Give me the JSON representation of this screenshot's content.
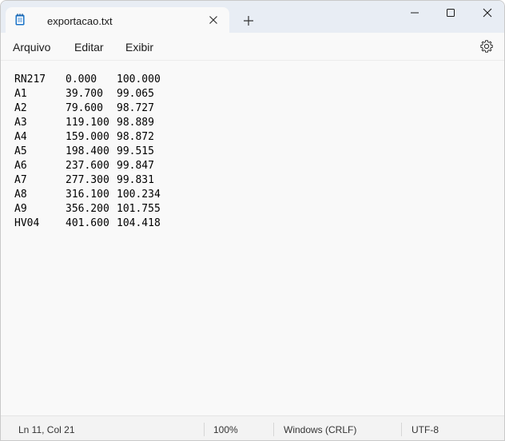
{
  "window": {
    "tab_title": "exportacao.txt",
    "new_tab_symbol": "+"
  },
  "menu": {
    "items": [
      "Arquivo",
      "Editar",
      "Exibir"
    ]
  },
  "document": {
    "lines": [
      [
        "RN217",
        "0.000",
        "100.000"
      ],
      [
        "A1",
        "39.700",
        "99.065"
      ],
      [
        "A2",
        "79.600",
        "98.727"
      ],
      [
        "A3",
        "119.100",
        "98.889"
      ],
      [
        "A4",
        "159.000",
        "98.872"
      ],
      [
        "A5",
        "198.400",
        "99.515"
      ],
      [
        "A6",
        "237.600",
        "99.847"
      ],
      [
        "A7",
        "277.300",
        "99.831"
      ],
      [
        "A8",
        "316.100",
        "100.234"
      ],
      [
        "A9",
        "356.200",
        "101.755"
      ],
      [
        "HV04",
        "401.600",
        "104.418"
      ]
    ]
  },
  "status": {
    "position": "Ln 11, Col 21",
    "zoom": "100%",
    "line_ending": "Windows (CRLF)",
    "encoding": "UTF-8"
  },
  "icons": {
    "app": "notepad-icon",
    "close_tab": "close-icon",
    "minimize": "minimize-icon",
    "maximize": "maximize-icon",
    "close_window": "close-icon",
    "settings": "gear-icon"
  },
  "colors": {
    "titlebar": "#e8edf4",
    "app_icon": "#1a73c8",
    "surface": "#f9f9f9",
    "statusbar": "#f3f3f3"
  }
}
